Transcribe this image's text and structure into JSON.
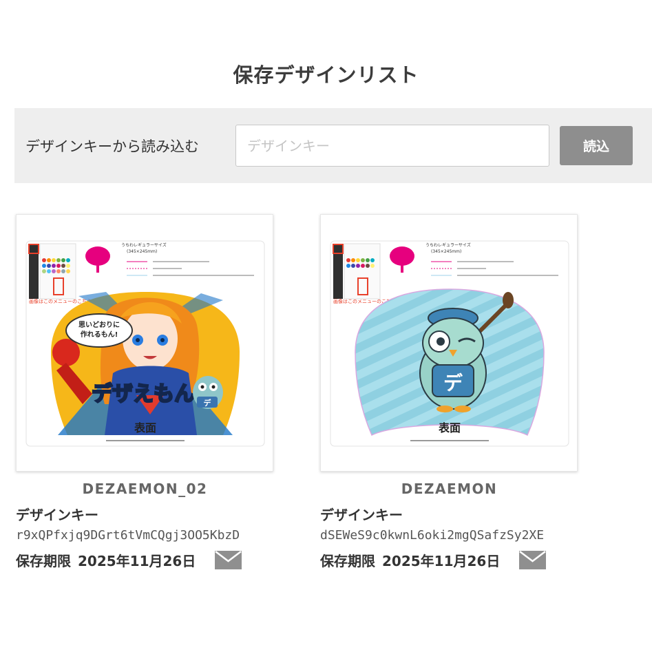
{
  "page": {
    "title": "保存デザインリスト"
  },
  "loader": {
    "label": "デザインキーから読み込む",
    "input_placeholder": "デザインキー",
    "input_value": "",
    "button_label": "読込"
  },
  "cards": [
    {
      "name": "DEZAEMON_02",
      "key_label": "デザインキー",
      "key_value": "r9xQPfxjq9DGrt6tVmCQgj3OO5KbzD",
      "expiry_label": "保存期限",
      "expiry_date": "2025年11月26日",
      "thumb": {
        "size_title": "うちわレギュラーサイズ",
        "size_dims": "(345×245mm)",
        "menu_note": "画像はこのメニューのこちらから",
        "side_label": "表面",
        "speech": "思いどおりに作れるもん!",
        "logo_text": "デザえもん",
        "badge": "デ"
      }
    },
    {
      "name": "DEZAEMON",
      "key_label": "デザインキー",
      "key_value": "dSEWeS9c0kwnL6oki2mgQSafzSy2XE",
      "expiry_label": "保存期限",
      "expiry_date": "2025年11月26日",
      "thumb": {
        "size_title": "うちわレギュラーサイズ",
        "size_dims": "(345×245mm)",
        "menu_note": "画像はこのメニューのこちらから",
        "side_label": "表面",
        "badge": "デ"
      }
    }
  ]
}
